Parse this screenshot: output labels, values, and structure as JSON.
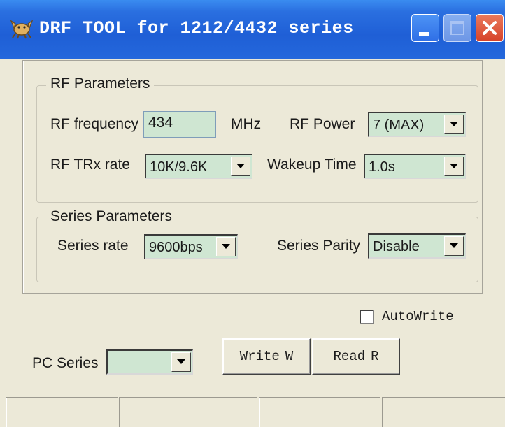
{
  "window": {
    "title": "DRF TOOL for 1212/4432 series",
    "app_icon": "crab-icon"
  },
  "rf_group": {
    "legend": "RF Parameters",
    "frequency_label": "RF frequency",
    "frequency_value": "434",
    "frequency_unit": "MHz",
    "power_label": "RF Power",
    "power_value": "7 (MAX)",
    "trx_rate_label": "RF TRx rate",
    "trx_rate_value": "10K/9.6K",
    "wakeup_label": "Wakeup Time",
    "wakeup_value": "1.0s"
  },
  "series_group": {
    "legend": "Series  Parameters",
    "rate_label": "Series rate",
    "rate_value": "9600bps",
    "parity_label": "Series Parity",
    "parity_value": "Disable"
  },
  "autowrite": {
    "label": "AutoWrite",
    "checked": false
  },
  "pc_series": {
    "label": "PC  Series",
    "value": ""
  },
  "buttons": {
    "write_label": "Write",
    "write_key": "W",
    "read_label": "Read",
    "read_key": "R"
  },
  "colors": {
    "titlebar": "#2468dc",
    "field_bg": "#cfe6d2",
    "window_bg": "#ece9d8"
  }
}
